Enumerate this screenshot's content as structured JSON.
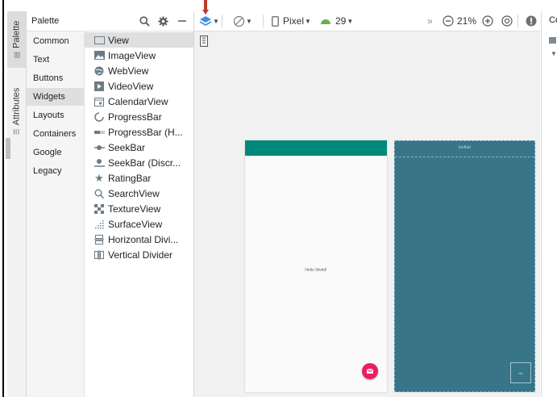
{
  "left_strip": {
    "tabs": [
      {
        "label": "Palette",
        "icon": "palette-icon"
      },
      {
        "label": "Attributes",
        "icon": "sliders-icon"
      }
    ]
  },
  "palette": {
    "title": "Palette",
    "header_icons": [
      "search-icon",
      "gear-icon",
      "minimize-icon"
    ],
    "categories": [
      "Common",
      "Text",
      "Buttons",
      "Widgets",
      "Layouts",
      "Containers",
      "Google",
      "Legacy"
    ],
    "selected_category": "Widgets",
    "widgets": [
      {
        "label": "View",
        "icon": "view-icon"
      },
      {
        "label": "ImageView",
        "icon": "image-icon"
      },
      {
        "label": "WebView",
        "icon": "globe-icon"
      },
      {
        "label": "VideoView",
        "icon": "video-icon"
      },
      {
        "label": "CalendarView",
        "icon": "calendar-icon"
      },
      {
        "label": "ProgressBar",
        "icon": "progress-circle-icon"
      },
      {
        "label": "ProgressBar (H...",
        "icon": "progress-horizontal-icon"
      },
      {
        "label": "SeekBar",
        "icon": "seekbar-icon"
      },
      {
        "label": "SeekBar (Discr...",
        "icon": "seekbar-discrete-icon"
      },
      {
        "label": "RatingBar",
        "icon": "star-icon"
      },
      {
        "label": "SearchView",
        "icon": "search-icon"
      },
      {
        "label": "TextureView",
        "icon": "texture-icon"
      },
      {
        "label": "SurfaceView",
        "icon": "surface-icon"
      },
      {
        "label": "Horizontal Divi...",
        "icon": "horizontal-divider-icon"
      },
      {
        "label": "Vertical Divider",
        "icon": "vertical-divider-icon"
      }
    ],
    "selected_widget": "View"
  },
  "toolbar": {
    "device": "Pixel",
    "api_level": "29",
    "zoom": "21%",
    "more": "»"
  },
  "design": {
    "hello_text": "Hello World!",
    "blueprint_appbar_text": "toolbar",
    "blueprint_fab_text": "fab"
  },
  "right_panel": {
    "label": "Co"
  },
  "colors": {
    "app_bar": "#00897b",
    "fab": "#e91e63",
    "blueprint": "#387588",
    "annotation_arrow": "#c0392b"
  }
}
